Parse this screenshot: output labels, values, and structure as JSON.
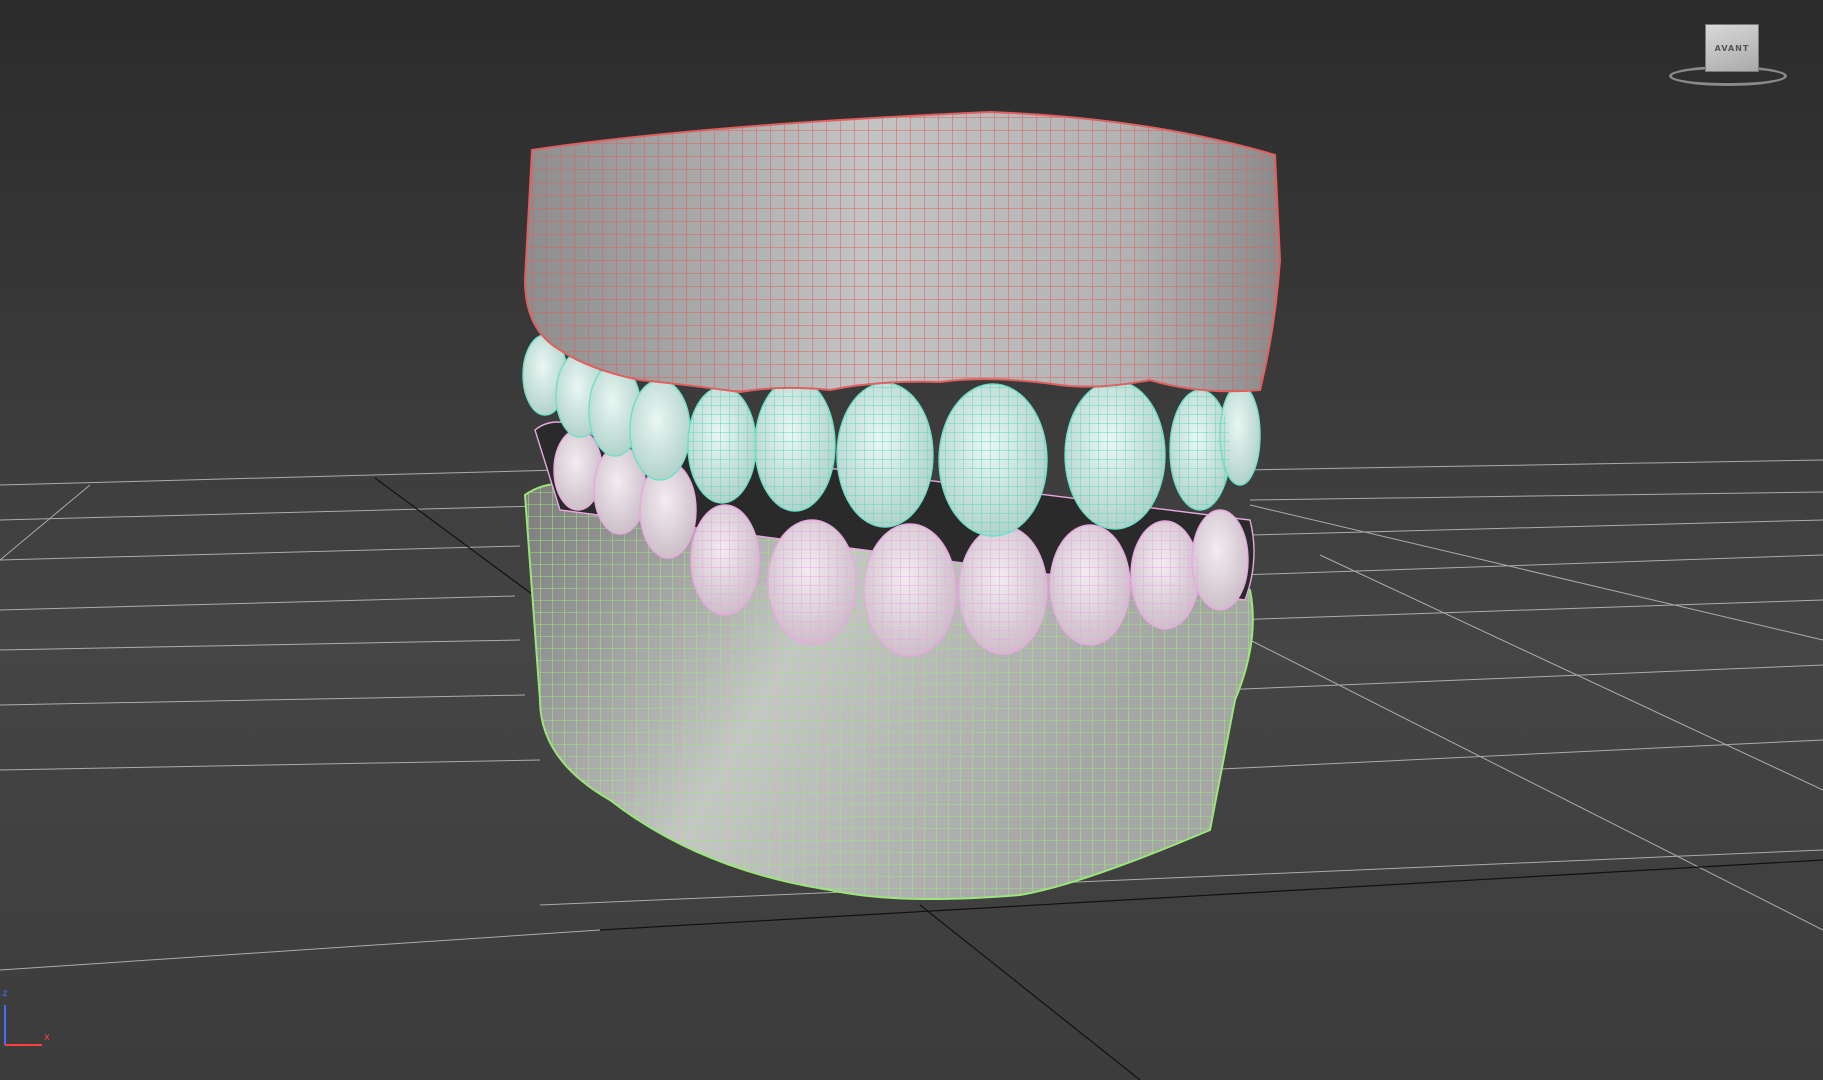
{
  "viewport": {
    "background_top": "#2b2b2b",
    "background_bottom": "#454545",
    "grid_color": "#d0d0d0",
    "grid_axis_color": "#111111"
  },
  "viewcube": {
    "face_label": "AVANT",
    "icon": "viewcube-icon"
  },
  "axis_tripod": {
    "z_label": "z",
    "x_label": "x",
    "z_color": "#4a6cff",
    "x_color": "#ff4040"
  },
  "objects": [
    {
      "name": "upper-gum",
      "wire_color": "#e06060"
    },
    {
      "name": "upper-teeth",
      "wire_color": "#6fe0c8"
    },
    {
      "name": "lower-teeth",
      "wire_color": "#e8a8e0"
    },
    {
      "name": "lower-gum",
      "wire_color": "#9ae67a"
    }
  ]
}
